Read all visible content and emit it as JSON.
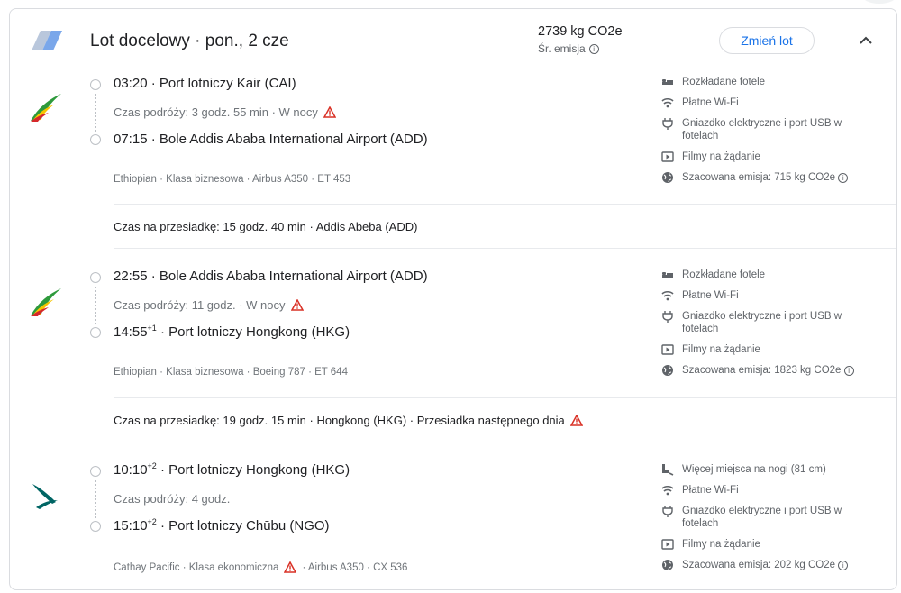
{
  "header": {
    "title": "Lot docelowy · pon., 2 cze",
    "co2": "2739 kg CO2e",
    "co2_sub": "Śr. emisja",
    "change_button": "Zmień lot",
    "collapse_icon": "chevron-up-icon"
  },
  "segments": [
    {
      "airline_icon": "ethiopian-airlines-logo",
      "dep_time": "03:20",
      "dep_sup": "",
      "dep_airport": "Port lotniczy Kair (CAI)",
      "duration": "Czas podróży: 3 godz. 55 min · W nocy",
      "arr_time": "07:15",
      "arr_sup": "",
      "arr_airport": "Bole Addis Ababa International Airport (ADD)",
      "meta": "Ethiopian · Klasa biznesowa · Airbus A350 · ET 453",
      "amenities": [
        {
          "icon": "flat-seat-icon",
          "text": "Rozkładane fotele"
        },
        {
          "icon": "wifi-icon",
          "text": "Płatne Wi-Fi"
        },
        {
          "icon": "power-plug-icon",
          "text": "Gniazdko elektryczne i port USB w fotelach"
        },
        {
          "icon": "play-video-icon",
          "text": "Filmy na żądanie"
        },
        {
          "icon": "globe-icon",
          "text": "Szacowana emisja: 715 kg CO2e"
        }
      ]
    },
    {
      "airline_icon": "ethiopian-airlines-logo",
      "dep_time": "22:55",
      "dep_sup": "",
      "dep_airport": "Bole Addis Ababa International Airport (ADD)",
      "duration": "Czas podróży: 11 godz. · W nocy",
      "arr_time": "14:55",
      "arr_sup": "+1",
      "arr_airport": "Port lotniczy Hongkong (HKG)",
      "meta": "Ethiopian · Klasa biznesowa · Boeing 787 · ET 644",
      "amenities": [
        {
          "icon": "flat-seat-icon",
          "text": "Rozkładane fotele"
        },
        {
          "icon": "wifi-icon",
          "text": "Płatne Wi-Fi"
        },
        {
          "icon": "power-plug-icon",
          "text": "Gniazdko elektryczne i port USB w fotelach"
        },
        {
          "icon": "play-video-icon",
          "text": "Filmy na żądanie"
        },
        {
          "icon": "globe-icon",
          "text": "Szacowana emisja: 1823 kg CO2e"
        }
      ]
    },
    {
      "airline_icon": "cathay-pacific-logo",
      "dep_time": "10:10",
      "dep_sup": "+2",
      "dep_airport": "Port lotniczy Hongkong (HKG)",
      "duration": "Czas podróży: 4 godz.",
      "arr_time": "15:10",
      "arr_sup": "+2",
      "arr_airport": "Port lotniczy Chūbu (NGO)",
      "meta_prefix": "Cathay Pacific · Klasa ekonomiczna",
      "meta_suffix": "· Airbus A350 · CX 536",
      "amenities": [
        {
          "icon": "legroom-seat-icon",
          "text": "Więcej miejsca na nogi (81 cm)"
        },
        {
          "icon": "wifi-icon",
          "text": "Płatne Wi-Fi"
        },
        {
          "icon": "power-plug-icon",
          "text": "Gniazdko elektryczne i port USB w fotelach"
        },
        {
          "icon": "play-video-icon",
          "text": "Filmy na żądanie"
        },
        {
          "icon": "globe-icon",
          "text": "Szacowana emisja: 202 kg CO2e"
        }
      ]
    }
  ],
  "layovers": [
    {
      "text": "Czas na przesiadkę: 15 godz. 40 min · Addis Abeba (ADD)"
    },
    {
      "text": "Czas na przesiadkę: 19 godz. 15 min · Hongkong (HKG) · Przesiadka następnego dnia"
    }
  ],
  "colors": {
    "accent": "#1a73e8",
    "warning": "#d93025",
    "ethiopian_green": "#2e9a3c",
    "ethiopian_yellow": "#f6c500",
    "ethiopian_red": "#d6282b",
    "cathay": "#006564"
  }
}
